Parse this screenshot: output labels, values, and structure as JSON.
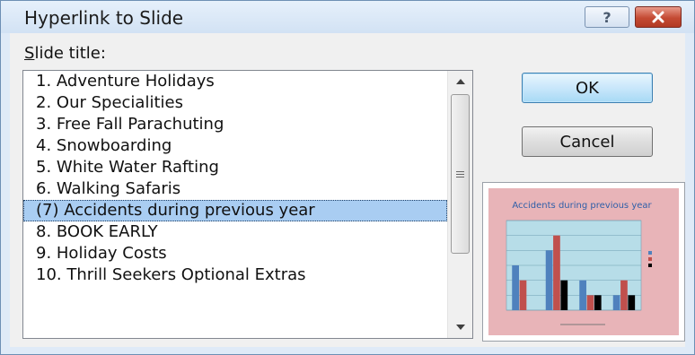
{
  "dialog": {
    "title": "Hyperlink to Slide",
    "help_glyph": "?",
    "close_icon": "close-icon"
  },
  "slide_title_label": {
    "mnemonic": "S",
    "rest": "lide title:"
  },
  "slides": [
    {
      "label": "1. Adventure Holidays",
      "selected": false
    },
    {
      "label": "2. Our Specialities",
      "selected": false
    },
    {
      "label": "3. Free Fall Parachuting",
      "selected": false
    },
    {
      "label": "4. Snowboarding",
      "selected": false
    },
    {
      "label": "5. White Water Rafting",
      "selected": false
    },
    {
      "label": "6. Walking Safaris",
      "selected": false
    },
    {
      "label": "(7) Accidents during previous year",
      "selected": true
    },
    {
      "label": "8. BOOK EARLY",
      "selected": false
    },
    {
      "label": "9. Holiday Costs",
      "selected": false
    },
    {
      "label": "10. Thrill Seekers Optional Extras",
      "selected": false
    }
  ],
  "buttons": {
    "ok": "OK",
    "cancel": "Cancel"
  },
  "preview": {
    "slide_title": "Accidents during previous year",
    "legend_entries": [
      "",
      "",
      ""
    ],
    "categories": [
      "",
      "",
      "",
      ""
    ],
    "series_colors": [
      "#4f81bd",
      "#c0504d",
      "#000000"
    ],
    "values": [
      [
        3,
        4,
        2,
        1
      ],
      [
        2,
        5,
        1,
        2
      ],
      [
        0,
        2,
        1,
        1
      ]
    ],
    "ylim": [
      0,
      6
    ]
  },
  "colors": {
    "selection": "#a9cdf2",
    "ok_accent": "#3c7fb1",
    "close_red": "#c44a33",
    "preview_bg": "#e8b4b8",
    "plot_bg": "#b7dde8"
  }
}
